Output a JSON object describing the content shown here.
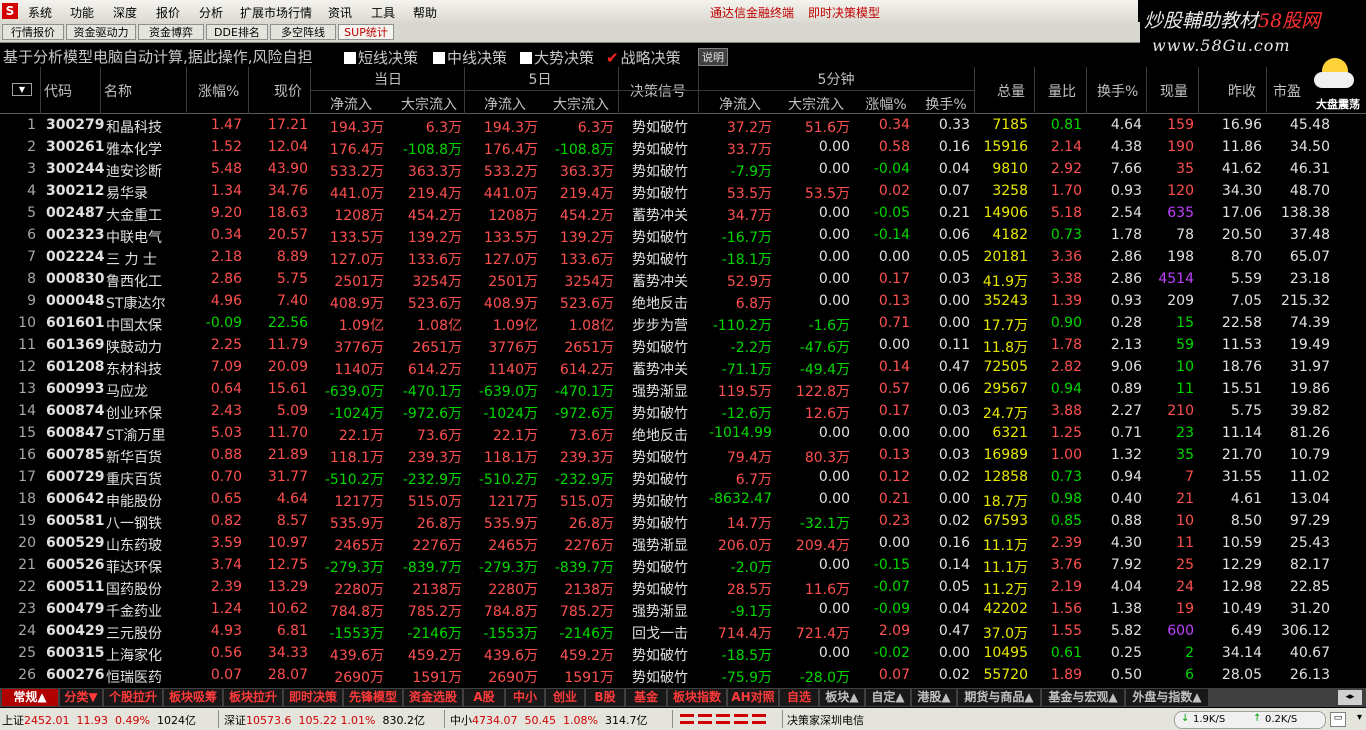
{
  "menu": {
    "logo": "S",
    "items": [
      "系统",
      "功能",
      "深度",
      "报价",
      "分析",
      "扩展市场行情",
      "资讯",
      "工具",
      "帮助"
    ],
    "right": [
      "通达信金融终端",
      "即时决策模型"
    ]
  },
  "brand": {
    "line1a": "炒股輔助教材",
    "line1b": "58股网",
    "line2": "www.58Gu.com"
  },
  "tabs": [
    "行情报价",
    "资金驱动力",
    "资金博弈",
    "DDE排名",
    "多空阵线",
    "SUP统计"
  ],
  "info": {
    "text": "基于分析模型电脑自动计算,据此操作,风险自担",
    "checks": [
      {
        "label": "短线决策",
        "checked": false
      },
      {
        "label": "中线决策",
        "checked": false
      },
      {
        "label": "大势决策",
        "checked": false
      },
      {
        "label": "战略决策",
        "checked": true
      }
    ],
    "help": "说明"
  },
  "weather": {
    "label": "大盘震荡",
    "icon": "sun-cloud-icon"
  },
  "header": {
    "sort_icon": "▼",
    "code": "代码",
    "name": "名称",
    "chg": "涨幅%",
    "price": "现价",
    "today": "当日",
    "day5": "5日",
    "net_in": "净流入",
    "big_in": "大宗流入",
    "signal": "决策信号",
    "min5": "5分钟",
    "turn": "换手%",
    "vol": "总量",
    "ratio": "量比",
    "cur": "现量",
    "prev": "昨收",
    "pe": "市盈"
  },
  "colors": {
    "red": "#ff5050",
    "green": "#00d800",
    "yellow": "#e8e800",
    "purple": "#c040ff"
  },
  "rows": [
    {
      "n": "1",
      "code": "300279",
      "name": "和晶科技",
      "chg": "1.47",
      "price": "17.21",
      "t_net": "194.3万",
      "t_big": "6.3万",
      "d_net": "194.3万",
      "d_big": "6.3万",
      "sig": "势如破竹",
      "m_net": "37.2万",
      "m_big": "51.6万",
      "m_chg": "0.34",
      "m_turn": "0.33",
      "vol": "7185",
      "ratio": "0.81",
      "turn": "4.64",
      "cur": "159",
      "prev": "16.96",
      "pe": "45.48",
      "cc": "red"
    },
    {
      "n": "2",
      "code": "300261",
      "name": "雅本化学",
      "chg": "1.52",
      "price": "12.04",
      "t_net": "176.4万",
      "t_big": "-108.8万",
      "d_net": "176.4万",
      "d_big": "-108.8万",
      "sig": "势如破竹",
      "m_net": "33.7万",
      "m_big": "0.00",
      "m_chg": "0.58",
      "m_turn": "0.16",
      "vol": "15916",
      "ratio": "2.14",
      "turn": "4.38",
      "cur": "190",
      "prev": "11.86",
      "pe": "34.50",
      "cc": "red"
    },
    {
      "n": "3",
      "code": "300244",
      "name": "迪安诊断",
      "chg": "5.48",
      "price": "43.90",
      "t_net": "533.2万",
      "t_big": "363.3万",
      "d_net": "533.2万",
      "d_big": "363.3万",
      "sig": "势如破竹",
      "m_net": "-7.9万",
      "m_big": "0.00",
      "m_chg": "-0.04",
      "m_turn": "0.04",
      "vol": "9810",
      "ratio": "2.92",
      "turn": "7.66",
      "cur": "35",
      "prev": "41.62",
      "pe": "46.31",
      "cc": "red"
    },
    {
      "n": "4",
      "code": "300212",
      "name": "易华录",
      "chg": "1.34",
      "price": "34.76",
      "t_net": "441.0万",
      "t_big": "219.4万",
      "d_net": "441.0万",
      "d_big": "219.4万",
      "sig": "势如破竹",
      "m_net": "53.5万",
      "m_big": "53.5万",
      "m_chg": "0.02",
      "m_turn": "0.07",
      "vol": "3258",
      "ratio": "1.70",
      "turn": "0.93",
      "cur": "120",
      "prev": "34.30",
      "pe": "48.70",
      "cc": "red"
    },
    {
      "n": "5",
      "code": "002487",
      "name": "大金重工",
      "chg": "9.20",
      "price": "18.63",
      "t_net": "1208万",
      "t_big": "454.2万",
      "d_net": "1208万",
      "d_big": "454.2万",
      "sig": "蓄势冲关",
      "m_net": "34.7万",
      "m_big": "0.00",
      "m_chg": "-0.05",
      "m_turn": "0.21",
      "vol": "14906",
      "ratio": "5.18",
      "turn": "2.54",
      "cur": "635",
      "prev": "17.06",
      "pe": "138.38",
      "cc": "pur"
    },
    {
      "n": "6",
      "code": "002323",
      "name": "中联电气",
      "chg": "0.34",
      "price": "20.57",
      "t_net": "133.5万",
      "t_big": "139.2万",
      "d_net": "133.5万",
      "d_big": "139.2万",
      "sig": "势如破竹",
      "m_net": "-16.7万",
      "m_big": "0.00",
      "m_chg": "-0.14",
      "m_turn": "0.06",
      "vol": "4182",
      "ratio": "0.73",
      "turn": "1.78",
      "cur": "78",
      "prev": "20.50",
      "pe": "37.48",
      "cc": "wht"
    },
    {
      "n": "7",
      "code": "002224",
      "name": "三 力 士",
      "chg": "2.18",
      "price": "8.89",
      "t_net": "127.0万",
      "t_big": "133.6万",
      "d_net": "127.0万",
      "d_big": "133.6万",
      "sig": "势如破竹",
      "m_net": "-18.1万",
      "m_big": "0.00",
      "m_chg": "0.00",
      "m_turn": "0.05",
      "vol": "20181",
      "ratio": "3.36",
      "turn": "2.86",
      "cur": "198",
      "prev": "8.70",
      "pe": "65.07",
      "cc": "wht"
    },
    {
      "n": "8",
      "code": "000830",
      "name": "鲁西化工",
      "chg": "2.86",
      "price": "5.75",
      "t_net": "2501万",
      "t_big": "3254万",
      "d_net": "2501万",
      "d_big": "3254万",
      "sig": "蓄势冲关",
      "m_net": "52.9万",
      "m_big": "0.00",
      "m_chg": "0.17",
      "m_turn": "0.03",
      "vol": "41.9万",
      "ratio": "3.38",
      "turn": "2.86",
      "cur": "4514",
      "prev": "5.59",
      "pe": "23.18",
      "cc": "pur"
    },
    {
      "n": "9",
      "code": "000048",
      "name": "ST康达尔",
      "chg": "4.96",
      "price": "7.40",
      "t_net": "408.9万",
      "t_big": "523.6万",
      "d_net": "408.9万",
      "d_big": "523.6万",
      "sig": "绝地反击",
      "m_net": "6.8万",
      "m_big": "0.00",
      "m_chg": "0.13",
      "m_turn": "0.00",
      "vol": "35243",
      "ratio": "1.39",
      "turn": "0.93",
      "cur": "209",
      "prev": "7.05",
      "pe": "215.32",
      "cc": "wht"
    },
    {
      "n": "10",
      "code": "601601",
      "name": "中国太保",
      "chg": "-0.09",
      "price": "22.56",
      "t_net": "1.09亿",
      "t_big": "1.08亿",
      "d_net": "1.09亿",
      "d_big": "1.08亿",
      "sig": "步步为营",
      "m_net": "-110.2万",
      "m_big": "-1.6万",
      "m_chg": "0.71",
      "m_turn": "0.00",
      "vol": "17.7万",
      "ratio": "0.90",
      "turn": "0.28",
      "cur": "15",
      "prev": "22.58",
      "pe": "74.39",
      "cc": "grn"
    },
    {
      "n": "11",
      "code": "601369",
      "name": "陕鼓动力",
      "chg": "2.25",
      "price": "11.79",
      "t_net": "3776万",
      "t_big": "2651万",
      "d_net": "3776万",
      "d_big": "2651万",
      "sig": "势如破竹",
      "m_net": "-2.2万",
      "m_big": "-47.6万",
      "m_chg": "0.00",
      "m_turn": "0.11",
      "vol": "11.8万",
      "ratio": "1.78",
      "turn": "2.13",
      "cur": "59",
      "prev": "11.53",
      "pe": "19.49",
      "cc": "grn"
    },
    {
      "n": "12",
      "code": "601208",
      "name": "东材科技",
      "chg": "7.09",
      "price": "20.09",
      "t_net": "1140万",
      "t_big": "614.2万",
      "d_net": "1140万",
      "d_big": "614.2万",
      "sig": "蓄势冲关",
      "m_net": "-71.1万",
      "m_big": "-49.4万",
      "m_chg": "0.14",
      "m_turn": "0.47",
      "vol": "72505",
      "ratio": "2.82",
      "turn": "9.06",
      "cur": "10",
      "prev": "18.76",
      "pe": "31.97",
      "cc": "grn"
    },
    {
      "n": "13",
      "code": "600993",
      "name": "马应龙",
      "chg": "0.64",
      "price": "15.61",
      "t_net": "-639.0万",
      "t_big": "-470.1万",
      "d_net": "-639.0万",
      "d_big": "-470.1万",
      "sig": "强势渐显",
      "m_net": "119.5万",
      "m_big": "122.8万",
      "m_chg": "0.57",
      "m_turn": "0.06",
      "vol": "29567",
      "ratio": "0.94",
      "turn": "0.89",
      "cur": "11",
      "prev": "15.51",
      "pe": "19.86",
      "cc": "grn"
    },
    {
      "n": "14",
      "code": "600874",
      "name": "创业环保",
      "chg": "2.43",
      "price": "5.09",
      "t_net": "-1024万",
      "t_big": "-972.6万",
      "d_net": "-1024万",
      "d_big": "-972.6万",
      "sig": "势如破竹",
      "m_net": "-12.6万",
      "m_big": "12.6万",
      "m_chg": "0.17",
      "m_turn": "0.03",
      "vol": "24.7万",
      "ratio": "3.88",
      "turn": "2.27",
      "cur": "210",
      "prev": "5.75",
      "pe": "39.82",
      "cc": "red"
    },
    {
      "n": "15",
      "code": "600847",
      "name": "ST渝万里",
      "chg": "5.03",
      "price": "11.70",
      "t_net": "22.1万",
      "t_big": "73.6万",
      "d_net": "22.1万",
      "d_big": "73.6万",
      "sig": "绝地反击",
      "m_net": "-1014.99",
      "m_big": "0.00",
      "m_chg": "0.00",
      "m_turn": "0.00",
      "vol": "6321",
      "ratio": "1.25",
      "turn": "0.71",
      "cur": "23",
      "prev": "11.14",
      "pe": "81.26",
      "cc": "grn"
    },
    {
      "n": "16",
      "code": "600785",
      "name": "新华百货",
      "chg": "0.88",
      "price": "21.89",
      "t_net": "118.1万",
      "t_big": "239.3万",
      "d_net": "118.1万",
      "d_big": "239.3万",
      "sig": "势如破竹",
      "m_net": "79.4万",
      "m_big": "80.3万",
      "m_chg": "0.13",
      "m_turn": "0.03",
      "vol": "16989",
      "ratio": "1.00",
      "turn": "1.32",
      "cur": "35",
      "prev": "21.70",
      "pe": "10.79",
      "cc": "grn"
    },
    {
      "n": "17",
      "code": "600729",
      "name": "重庆百货",
      "chg": "0.70",
      "price": "31.77",
      "t_net": "-510.2万",
      "t_big": "-232.9万",
      "d_net": "-510.2万",
      "d_big": "-232.9万",
      "sig": "势如破竹",
      "m_net": "6.7万",
      "m_big": "0.00",
      "m_chg": "0.12",
      "m_turn": "0.02",
      "vol": "12858",
      "ratio": "0.73",
      "turn": "0.94",
      "cur": "7",
      "prev": "31.55",
      "pe": "11.02",
      "cc": "red"
    },
    {
      "n": "18",
      "code": "600642",
      "name": "申能股份",
      "chg": "0.65",
      "price": "4.64",
      "t_net": "1217万",
      "t_big": "515.0万",
      "d_net": "1217万",
      "d_big": "515.0万",
      "sig": "势如破竹",
      "m_net": "-8632.47",
      "m_big": "0.00",
      "m_chg": "0.21",
      "m_turn": "0.00",
      "vol": "18.7万",
      "ratio": "0.98",
      "turn": "0.40",
      "cur": "21",
      "prev": "4.61",
      "pe": "13.04",
      "cc": "red"
    },
    {
      "n": "19",
      "code": "600581",
      "name": "八一钢铁",
      "chg": "0.82",
      "price": "8.57",
      "t_net": "535.9万",
      "t_big": "26.8万",
      "d_net": "535.9万",
      "d_big": "26.8万",
      "sig": "势如破竹",
      "m_net": "14.7万",
      "m_big": "-32.1万",
      "m_chg": "0.23",
      "m_turn": "0.02",
      "vol": "67593",
      "ratio": "0.85",
      "turn": "0.88",
      "cur": "10",
      "prev": "8.50",
      "pe": "97.29",
      "cc": "red"
    },
    {
      "n": "20",
      "code": "600529",
      "name": "山东药玻",
      "chg": "3.59",
      "price": "10.97",
      "t_net": "2465万",
      "t_big": "2276万",
      "d_net": "2465万",
      "d_big": "2276万",
      "sig": "强势渐显",
      "m_net": "206.0万",
      "m_big": "209.4万",
      "m_chg": "0.00",
      "m_turn": "0.16",
      "vol": "11.1万",
      "ratio": "2.39",
      "turn": "4.30",
      "cur": "11",
      "prev": "10.59",
      "pe": "25.43",
      "cc": "red"
    },
    {
      "n": "21",
      "code": "600526",
      "name": "菲达环保",
      "chg": "3.74",
      "price": "12.75",
      "t_net": "-279.3万",
      "t_big": "-839.7万",
      "d_net": "-279.3万",
      "d_big": "-839.7万",
      "sig": "势如破竹",
      "m_net": "-2.0万",
      "m_big": "0.00",
      "m_chg": "-0.15",
      "m_turn": "0.14",
      "vol": "11.1万",
      "ratio": "3.76",
      "turn": "7.92",
      "cur": "25",
      "prev": "12.29",
      "pe": "82.17",
      "cc": "red"
    },
    {
      "n": "22",
      "code": "600511",
      "name": "国药股份",
      "chg": "2.39",
      "price": "13.29",
      "t_net": "2280万",
      "t_big": "2138万",
      "d_net": "2280万",
      "d_big": "2138万",
      "sig": "势如破竹",
      "m_net": "28.5万",
      "m_big": "11.6万",
      "m_chg": "-0.07",
      "m_turn": "0.05",
      "vol": "11.2万",
      "ratio": "2.19",
      "turn": "4.04",
      "cur": "24",
      "prev": "12.98",
      "pe": "22.85",
      "cc": "red"
    },
    {
      "n": "23",
      "code": "600479",
      "name": "千金药业",
      "chg": "1.24",
      "price": "10.62",
      "t_net": "784.8万",
      "t_big": "785.2万",
      "d_net": "784.8万",
      "d_big": "785.2万",
      "sig": "强势渐显",
      "m_net": "-9.1万",
      "m_big": "0.00",
      "m_chg": "-0.09",
      "m_turn": "0.04",
      "vol": "42202",
      "ratio": "1.56",
      "turn": "1.38",
      "cur": "19",
      "prev": "10.49",
      "pe": "31.20",
      "cc": "red"
    },
    {
      "n": "24",
      "code": "600429",
      "name": "三元股份",
      "chg": "4.93",
      "price": "6.81",
      "t_net": "-1553万",
      "t_big": "-2146万",
      "d_net": "-1553万",
      "d_big": "-2146万",
      "sig": "回戈一击",
      "m_net": "714.4万",
      "m_big": "721.4万",
      "m_chg": "2.09",
      "m_turn": "0.47",
      "vol": "37.0万",
      "ratio": "1.55",
      "turn": "5.82",
      "cur": "600",
      "prev": "6.49",
      "pe": "306.12",
      "cc": "pur"
    },
    {
      "n": "25",
      "code": "600315",
      "name": "上海家化",
      "chg": "0.56",
      "price": "34.33",
      "t_net": "439.6万",
      "t_big": "459.2万",
      "d_net": "439.6万",
      "d_big": "459.2万",
      "sig": "势如破竹",
      "m_net": "-18.5万",
      "m_big": "0.00",
      "m_chg": "-0.02",
      "m_turn": "0.00",
      "vol": "10495",
      "ratio": "0.61",
      "turn": "0.25",
      "cur": "2",
      "prev": "34.14",
      "pe": "40.67",
      "cc": "grn"
    },
    {
      "n": "26",
      "code": "600276",
      "name": "恒瑞医药",
      "chg": "0.07",
      "price": "28.07",
      "t_net": "2690万",
      "t_big": "1591万",
      "d_net": "2690万",
      "d_big": "1591万",
      "sig": "势如破竹",
      "m_net": "-75.9万",
      "m_big": "-28.0万",
      "m_chg": "0.07",
      "m_turn": "0.02",
      "vol": "55720",
      "ratio": "1.89",
      "turn": "0.50",
      "cur": "6",
      "prev": "28.05",
      "pe": "26.13",
      "cc": "grn"
    }
  ],
  "bottom_tabs": [
    "常规▲",
    "分类▼",
    "个股拉升",
    "板块吸筹",
    "板块拉升",
    "即时决策",
    "先锋模型",
    "资金选股",
    "A股",
    "中小",
    "创业",
    "B股",
    "基金",
    "板块指数",
    "AH对照",
    "自选",
    "板块▲",
    "自定▲",
    "港股▲",
    "期货与商品▲",
    "基金与宏观▲",
    "外盘与指数▲"
  ],
  "status": {
    "sh_label": "上证",
    "sh_val": "2452.01",
    "sh_chg": "11.93",
    "sh_pct": "0.49%",
    "sh_amt": "1024亿",
    "sz_label": "深证",
    "sz_val": "10573.6",
    "sz_chg": "105.22",
    "sz_pct": "1.01%",
    "sz_amt": "830.2亿",
    "zx_label": "中小",
    "zx_val": "4734.07",
    "zx_chg": "50.45",
    "zx_pct": "1.08%",
    "zx_amt": "314.7亿",
    "source": "决策家深圳电信",
    "down": "1.9K/S",
    "up": "0.2K/S"
  }
}
